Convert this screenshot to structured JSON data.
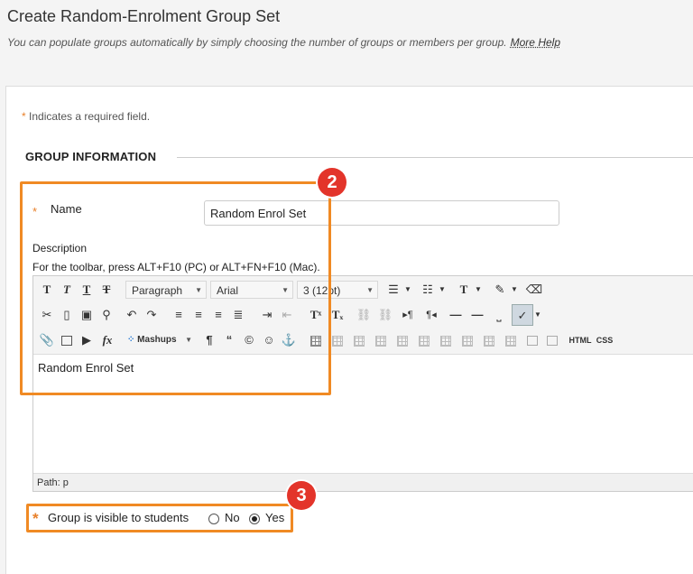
{
  "header": {
    "title": "Create Random-Enrolment Group Set",
    "subtitle": "You can populate groups automatically by simply choosing the number of groups or members per group.",
    "more_help": "More Help"
  },
  "form": {
    "required_note": "Indicates a required field.",
    "required_star": "*",
    "section_title": "GROUP INFORMATION",
    "name_label": "Name",
    "name_value": "Random Enrol Set",
    "description_label": "Description",
    "toolbar_hint": "For the toolbar, press ALT+F10 (PC) or ALT+FN+F10 (Mac).",
    "visibility_label": "Group is visible to students",
    "visibility_options": [
      "No",
      "Yes"
    ],
    "visibility_selected": "Yes"
  },
  "editor": {
    "paragraph_select": "Paragraph",
    "font_select": "Arial",
    "size_select": "3 (12pt)",
    "mashups_label": "Mashups",
    "html_button": "HTML",
    "css_button": "CSS",
    "content": "Random Enrol Set",
    "path": "Path: p",
    "glyphs": {
      "bold": "T",
      "italic": "T",
      "underline": "T",
      "strike": "T",
      "superscript": "Tˣ",
      "subscript": "Tₓ",
      "paragraph_mark": "¶",
      "quote": "“",
      "copyright": "©",
      "smiley": "☺",
      "anchor": "⚓",
      "fx": "fx",
      "ltr": "▸¶",
      "rtl": "¶◂"
    }
  },
  "callouts": {
    "box2_number": "2",
    "box3_number": "3"
  },
  "colors": {
    "accent_orange": "#f08a24",
    "badge_red": "#e3342a",
    "required_star": "#e8802a"
  }
}
